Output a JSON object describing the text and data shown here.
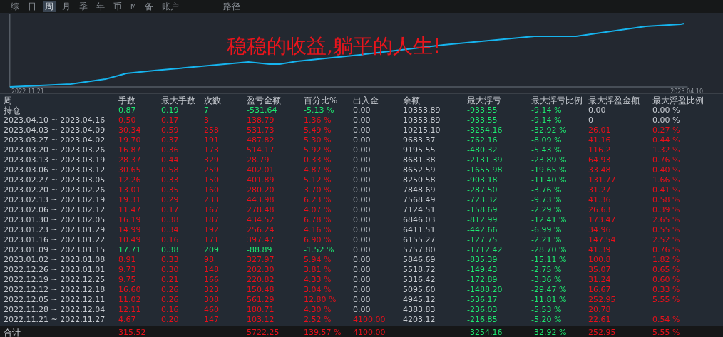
{
  "tabs": [
    {
      "label": "综",
      "selected": false
    },
    {
      "label": "日",
      "selected": false
    },
    {
      "label": "周",
      "selected": true
    },
    {
      "label": "月",
      "selected": false
    },
    {
      "label": "季",
      "selected": false
    },
    {
      "label": "年",
      "selected": false
    },
    {
      "label": "币",
      "selected": false
    },
    {
      "label": "M",
      "selected": false
    },
    {
      "label": "备",
      "selected": false
    },
    {
      "label": "账户",
      "selected": false
    },
    {
      "label": "路径",
      "selected": false
    }
  ],
  "chart": {
    "overlay_text": "稳稳的收益,躺平的人生!",
    "start_label": "2022.11.21",
    "end_label": "2023.04.10"
  },
  "table": {
    "label_column": "周",
    "columns": [
      "手数",
      "最大手数",
      "次数",
      "盈亏金额",
      "百分比%",
      "出入金",
      "余额",
      "最大浮亏",
      "最大浮亏比例",
      "最大浮盈金额",
      "最大浮盈比例"
    ],
    "position": {
      "label": "持仓",
      "cells": [
        {
          "text": "0.87",
          "color": "#1ee870"
        },
        {
          "text": "0.19",
          "color": "#1ee870"
        },
        {
          "text": "7",
          "color": "#1ee870"
        },
        {
          "text": "-531.64",
          "color": "#1ee870"
        },
        {
          "text": "-5.13 %",
          "color": "#1ee870"
        },
        {
          "text": "0.00",
          "color": "#c8ccd2"
        },
        {
          "text": "10353.89",
          "color": "#c8ccd2"
        },
        {
          "text": "-933.55",
          "color": "#1ee870"
        },
        {
          "text": "-9.14 %",
          "color": "#1ee870"
        },
        {
          "text": "0.00",
          "color": "#c8ccd2"
        },
        {
          "text": "0.00 %",
          "color": "#c8ccd2"
        }
      ]
    },
    "rows": [
      {
        "label": "2023.04.10 ~ 2023.04.16",
        "cells": [
          {
            "text": "0.50",
            "color": "#e8101a"
          },
          {
            "text": "0.17",
            "color": "#e8101a"
          },
          {
            "text": "3",
            "color": "#e8101a"
          },
          {
            "text": "138.79",
            "color": "#e8101a"
          },
          {
            "text": "1.36 %",
            "color": "#e8101a"
          },
          {
            "text": "0.00",
            "color": "#c8ccd2"
          },
          {
            "text": "10353.89",
            "color": "#c8ccd2"
          },
          {
            "text": "-933.55",
            "color": "#1ee870"
          },
          {
            "text": "-9.14 %",
            "color": "#1ee870"
          },
          {
            "text": "0",
            "color": "#c8ccd2"
          },
          {
            "text": "0.00 %",
            "color": "#c8ccd2"
          }
        ]
      },
      {
        "label": "2023.04.03 ~ 2023.04.09",
        "cells": [
          {
            "text": "30.34",
            "color": "#e8101a"
          },
          {
            "text": "0.59",
            "color": "#e8101a"
          },
          {
            "text": "258",
            "color": "#e8101a"
          },
          {
            "text": "531.73",
            "color": "#e8101a"
          },
          {
            "text": "5.49 %",
            "color": "#e8101a"
          },
          {
            "text": "0.00",
            "color": "#c8ccd2"
          },
          {
            "text": "10215.10",
            "color": "#c8ccd2"
          },
          {
            "text": "-3254.16",
            "color": "#1ee870"
          },
          {
            "text": "-32.92 %",
            "color": "#1ee870"
          },
          {
            "text": "26.01",
            "color": "#e8101a"
          },
          {
            "text": "0.27 %",
            "color": "#e8101a"
          }
        ]
      },
      {
        "label": "2023.03.27 ~ 2023.04.02",
        "cells": [
          {
            "text": "19.70",
            "color": "#e8101a"
          },
          {
            "text": "0.37",
            "color": "#e8101a"
          },
          {
            "text": "191",
            "color": "#e8101a"
          },
          {
            "text": "487.82",
            "color": "#e8101a"
          },
          {
            "text": "5.30 %",
            "color": "#e8101a"
          },
          {
            "text": "0.00",
            "color": "#c8ccd2"
          },
          {
            "text": "9683.37",
            "color": "#c8ccd2"
          },
          {
            "text": "-762.16",
            "color": "#1ee870"
          },
          {
            "text": "-8.09 %",
            "color": "#1ee870"
          },
          {
            "text": "41.16",
            "color": "#e8101a"
          },
          {
            "text": "0.44 %",
            "color": "#e8101a"
          }
        ]
      },
      {
        "label": "2023.03.20 ~ 2023.03.26",
        "cells": [
          {
            "text": "16.87",
            "color": "#e8101a"
          },
          {
            "text": "0.36",
            "color": "#e8101a"
          },
          {
            "text": "173",
            "color": "#e8101a"
          },
          {
            "text": "514.17",
            "color": "#e8101a"
          },
          {
            "text": "5.92 %",
            "color": "#e8101a"
          },
          {
            "text": "0.00",
            "color": "#c8ccd2"
          },
          {
            "text": "9195.55",
            "color": "#c8ccd2"
          },
          {
            "text": "-480.32",
            "color": "#1ee870"
          },
          {
            "text": "-5.43 %",
            "color": "#1ee870"
          },
          {
            "text": "116.2",
            "color": "#e8101a"
          },
          {
            "text": "1.32 %",
            "color": "#e8101a"
          }
        ]
      },
      {
        "label": "2023.03.13 ~ 2023.03.19",
        "cells": [
          {
            "text": "28.37",
            "color": "#e8101a"
          },
          {
            "text": "0.44",
            "color": "#e8101a"
          },
          {
            "text": "329",
            "color": "#e8101a"
          },
          {
            "text": "28.79",
            "color": "#e8101a"
          },
          {
            "text": "0.33 %",
            "color": "#e8101a"
          },
          {
            "text": "0.00",
            "color": "#c8ccd2"
          },
          {
            "text": "8681.38",
            "color": "#c8ccd2"
          },
          {
            "text": "-2131.39",
            "color": "#1ee870"
          },
          {
            "text": "-23.89 %",
            "color": "#1ee870"
          },
          {
            "text": "64.93",
            "color": "#e8101a"
          },
          {
            "text": "0.76 %",
            "color": "#e8101a"
          }
        ]
      },
      {
        "label": "2023.03.06 ~ 2023.03.12",
        "cells": [
          {
            "text": "30.65",
            "color": "#e8101a"
          },
          {
            "text": "0.58",
            "color": "#e8101a"
          },
          {
            "text": "259",
            "color": "#e8101a"
          },
          {
            "text": "402.01",
            "color": "#e8101a"
          },
          {
            "text": "4.87 %",
            "color": "#e8101a"
          },
          {
            "text": "0.00",
            "color": "#c8ccd2"
          },
          {
            "text": "8652.59",
            "color": "#c8ccd2"
          },
          {
            "text": "-1655.98",
            "color": "#1ee870"
          },
          {
            "text": "-19.65 %",
            "color": "#1ee870"
          },
          {
            "text": "33.48",
            "color": "#e8101a"
          },
          {
            "text": "0.40 %",
            "color": "#e8101a"
          }
        ]
      },
      {
        "label": "2023.02.27 ~ 2023.03.05",
        "cells": [
          {
            "text": "12.26",
            "color": "#e8101a"
          },
          {
            "text": "0.33",
            "color": "#e8101a"
          },
          {
            "text": "150",
            "color": "#e8101a"
          },
          {
            "text": "401.89",
            "color": "#e8101a"
          },
          {
            "text": "5.12 %",
            "color": "#e8101a"
          },
          {
            "text": "0.00",
            "color": "#c8ccd2"
          },
          {
            "text": "8250.58",
            "color": "#c8ccd2"
          },
          {
            "text": "-903.18",
            "color": "#1ee870"
          },
          {
            "text": "-11.40 %",
            "color": "#1ee870"
          },
          {
            "text": "131.77",
            "color": "#e8101a"
          },
          {
            "text": "1.66 %",
            "color": "#e8101a"
          }
        ]
      },
      {
        "label": "2023.02.20 ~ 2023.02.26",
        "cells": [
          {
            "text": "13.01",
            "color": "#e8101a"
          },
          {
            "text": "0.35",
            "color": "#e8101a"
          },
          {
            "text": "160",
            "color": "#e8101a"
          },
          {
            "text": "280.20",
            "color": "#e8101a"
          },
          {
            "text": "3.70 %",
            "color": "#e8101a"
          },
          {
            "text": "0.00",
            "color": "#c8ccd2"
          },
          {
            "text": "7848.69",
            "color": "#c8ccd2"
          },
          {
            "text": "-287.50",
            "color": "#1ee870"
          },
          {
            "text": "-3.76 %",
            "color": "#1ee870"
          },
          {
            "text": "31.27",
            "color": "#e8101a"
          },
          {
            "text": "0.41 %",
            "color": "#e8101a"
          }
        ]
      },
      {
        "label": "2023.02.13 ~ 2023.02.19",
        "cells": [
          {
            "text": "19.31",
            "color": "#e8101a"
          },
          {
            "text": "0.29",
            "color": "#e8101a"
          },
          {
            "text": "233",
            "color": "#e8101a"
          },
          {
            "text": "443.98",
            "color": "#e8101a"
          },
          {
            "text": "6.23 %",
            "color": "#e8101a"
          },
          {
            "text": "0.00",
            "color": "#c8ccd2"
          },
          {
            "text": "7568.49",
            "color": "#c8ccd2"
          },
          {
            "text": "-723.32",
            "color": "#1ee870"
          },
          {
            "text": "-9.73 %",
            "color": "#1ee870"
          },
          {
            "text": "41.36",
            "color": "#e8101a"
          },
          {
            "text": "0.58 %",
            "color": "#e8101a"
          }
        ]
      },
      {
        "label": "2023.02.06 ~ 2023.02.12",
        "cells": [
          {
            "text": "11.47",
            "color": "#e8101a"
          },
          {
            "text": "0.17",
            "color": "#e8101a"
          },
          {
            "text": "167",
            "color": "#e8101a"
          },
          {
            "text": "278.48",
            "color": "#e8101a"
          },
          {
            "text": "4.07 %",
            "color": "#e8101a"
          },
          {
            "text": "0.00",
            "color": "#c8ccd2"
          },
          {
            "text": "7124.51",
            "color": "#c8ccd2"
          },
          {
            "text": "-158.69",
            "color": "#1ee870"
          },
          {
            "text": "-2.29 %",
            "color": "#1ee870"
          },
          {
            "text": "26.63",
            "color": "#e8101a"
          },
          {
            "text": "0.39 %",
            "color": "#e8101a"
          }
        ]
      },
      {
        "label": "2023.01.30 ~ 2023.02.05",
        "cells": [
          {
            "text": "16.19",
            "color": "#e8101a"
          },
          {
            "text": "0.38",
            "color": "#e8101a"
          },
          {
            "text": "187",
            "color": "#e8101a"
          },
          {
            "text": "434.52",
            "color": "#e8101a"
          },
          {
            "text": "6.78 %",
            "color": "#e8101a"
          },
          {
            "text": "0.00",
            "color": "#c8ccd2"
          },
          {
            "text": "6846.03",
            "color": "#c8ccd2"
          },
          {
            "text": "-812.99",
            "color": "#1ee870"
          },
          {
            "text": "-12.41 %",
            "color": "#1ee870"
          },
          {
            "text": "173.47",
            "color": "#e8101a"
          },
          {
            "text": "2.65 %",
            "color": "#e8101a"
          }
        ]
      },
      {
        "label": "2023.01.23 ~ 2023.01.29",
        "cells": [
          {
            "text": "14.99",
            "color": "#e8101a"
          },
          {
            "text": "0.34",
            "color": "#e8101a"
          },
          {
            "text": "192",
            "color": "#e8101a"
          },
          {
            "text": "256.24",
            "color": "#e8101a"
          },
          {
            "text": "4.16 %",
            "color": "#e8101a"
          },
          {
            "text": "0.00",
            "color": "#c8ccd2"
          },
          {
            "text": "6411.51",
            "color": "#c8ccd2"
          },
          {
            "text": "-442.66",
            "color": "#1ee870"
          },
          {
            "text": "-6.99 %",
            "color": "#1ee870"
          },
          {
            "text": "34.96",
            "color": "#e8101a"
          },
          {
            "text": "0.55 %",
            "color": "#e8101a"
          }
        ]
      },
      {
        "label": "2023.01.16 ~ 2023.01.22",
        "cells": [
          {
            "text": "10.49",
            "color": "#e8101a"
          },
          {
            "text": "0.16",
            "color": "#e8101a"
          },
          {
            "text": "171",
            "color": "#e8101a"
          },
          {
            "text": "397.47",
            "color": "#e8101a"
          },
          {
            "text": "6.90 %",
            "color": "#e8101a"
          },
          {
            "text": "0.00",
            "color": "#c8ccd2"
          },
          {
            "text": "6155.27",
            "color": "#c8ccd2"
          },
          {
            "text": "-127.75",
            "color": "#1ee870"
          },
          {
            "text": "-2.21 %",
            "color": "#1ee870"
          },
          {
            "text": "147.54",
            "color": "#e8101a"
          },
          {
            "text": "2.52 %",
            "color": "#e8101a"
          }
        ]
      },
      {
        "label": "2023.01.09 ~ 2023.01.15",
        "cells": [
          {
            "text": "17.71",
            "color": "#1ee870"
          },
          {
            "text": "0.38",
            "color": "#1ee870"
          },
          {
            "text": "209",
            "color": "#1ee870"
          },
          {
            "text": "-88.89",
            "color": "#1ee870"
          },
          {
            "text": "-1.52 %",
            "color": "#1ee870"
          },
          {
            "text": "0.00",
            "color": "#c8ccd2"
          },
          {
            "text": "5757.80",
            "color": "#c8ccd2"
          },
          {
            "text": "-1712.42",
            "color": "#1ee870"
          },
          {
            "text": "-28.70 %",
            "color": "#1ee870"
          },
          {
            "text": "41.39",
            "color": "#e8101a"
          },
          {
            "text": "0.76 %",
            "color": "#e8101a"
          }
        ]
      },
      {
        "label": "2023.01.02 ~ 2023.01.08",
        "cells": [
          {
            "text": "8.91",
            "color": "#e8101a"
          },
          {
            "text": "0.33",
            "color": "#e8101a"
          },
          {
            "text": "98",
            "color": "#e8101a"
          },
          {
            "text": "327.97",
            "color": "#e8101a"
          },
          {
            "text": "5.94 %",
            "color": "#e8101a"
          },
          {
            "text": "0.00",
            "color": "#c8ccd2"
          },
          {
            "text": "5846.69",
            "color": "#c8ccd2"
          },
          {
            "text": "-835.39",
            "color": "#1ee870"
          },
          {
            "text": "-15.11 %",
            "color": "#1ee870"
          },
          {
            "text": "100.8",
            "color": "#e8101a"
          },
          {
            "text": "1.82 %",
            "color": "#e8101a"
          }
        ]
      },
      {
        "label": "2022.12.26 ~ 2023.01.01",
        "cells": [
          {
            "text": "9.73",
            "color": "#e8101a"
          },
          {
            "text": "0.30",
            "color": "#e8101a"
          },
          {
            "text": "148",
            "color": "#e8101a"
          },
          {
            "text": "202.30",
            "color": "#e8101a"
          },
          {
            "text": "3.81 %",
            "color": "#e8101a"
          },
          {
            "text": "0.00",
            "color": "#c8ccd2"
          },
          {
            "text": "5518.72",
            "color": "#c8ccd2"
          },
          {
            "text": "-149.43",
            "color": "#1ee870"
          },
          {
            "text": "-2.75 %",
            "color": "#1ee870"
          },
          {
            "text": "35.07",
            "color": "#e8101a"
          },
          {
            "text": "0.65 %",
            "color": "#e8101a"
          }
        ]
      },
      {
        "label": "2022.12.19 ~ 2022.12.25",
        "cells": [
          {
            "text": "9.75",
            "color": "#e8101a"
          },
          {
            "text": "0.21",
            "color": "#e8101a"
          },
          {
            "text": "166",
            "color": "#e8101a"
          },
          {
            "text": "220.82",
            "color": "#e8101a"
          },
          {
            "text": "4.33 %",
            "color": "#e8101a"
          },
          {
            "text": "0.00",
            "color": "#c8ccd2"
          },
          {
            "text": "5316.42",
            "color": "#c8ccd2"
          },
          {
            "text": "-172.89",
            "color": "#1ee870"
          },
          {
            "text": "-3.36 %",
            "color": "#1ee870"
          },
          {
            "text": "31.24",
            "color": "#e8101a"
          },
          {
            "text": "0.60 %",
            "color": "#e8101a"
          }
        ]
      },
      {
        "label": "2022.12.12 ~ 2022.12.18",
        "cells": [
          {
            "text": "16.60",
            "color": "#e8101a"
          },
          {
            "text": "0.26",
            "color": "#e8101a"
          },
          {
            "text": "323",
            "color": "#e8101a"
          },
          {
            "text": "150.48",
            "color": "#e8101a"
          },
          {
            "text": "3.04 %",
            "color": "#e8101a"
          },
          {
            "text": "0.00",
            "color": "#c8ccd2"
          },
          {
            "text": "5095.60",
            "color": "#c8ccd2"
          },
          {
            "text": "-1488.20",
            "color": "#1ee870"
          },
          {
            "text": "-29.47 %",
            "color": "#1ee870"
          },
          {
            "text": "16.67",
            "color": "#e8101a"
          },
          {
            "text": "0.33 %",
            "color": "#e8101a"
          }
        ]
      },
      {
        "label": "2022.12.05 ~ 2022.12.11",
        "cells": [
          {
            "text": "11.02",
            "color": "#e8101a"
          },
          {
            "text": "0.26",
            "color": "#e8101a"
          },
          {
            "text": "308",
            "color": "#e8101a"
          },
          {
            "text": "561.29",
            "color": "#e8101a"
          },
          {
            "text": "12.80 %",
            "color": "#e8101a"
          },
          {
            "text": "0.00",
            "color": "#c8ccd2"
          },
          {
            "text": "4945.12",
            "color": "#c8ccd2"
          },
          {
            "text": "-536.17",
            "color": "#1ee870"
          },
          {
            "text": "-11.81 %",
            "color": "#1ee870"
          },
          {
            "text": "252.95",
            "color": "#e8101a"
          },
          {
            "text": "5.55 %",
            "color": "#e8101a"
          }
        ]
      },
      {
        "label": "2022.11.28 ~ 2022.12.04",
        "cells": [
          {
            "text": "12.11",
            "color": "#e8101a"
          },
          {
            "text": "0.16",
            "color": "#e8101a"
          },
          {
            "text": "460",
            "color": "#e8101a"
          },
          {
            "text": "180.71",
            "color": "#e8101a"
          },
          {
            "text": "4.30 %",
            "color": "#e8101a"
          },
          {
            "text": "0.00",
            "color": "#c8ccd2"
          },
          {
            "text": "4383.83",
            "color": "#c8ccd2"
          },
          {
            "text": "-236.03",
            "color": "#1ee870"
          },
          {
            "text": "-5.53 %",
            "color": "#1ee870"
          },
          {
            "text": "20.78",
            "color": "#e8101a"
          },
          null
        ]
      },
      {
        "label": "2022.11.21 ~ 2022.11.27",
        "cells": [
          {
            "text": "4.67",
            "color": "#e8101a"
          },
          {
            "text": "0.20",
            "color": "#e8101a"
          },
          {
            "text": "147",
            "color": "#e8101a"
          },
          {
            "text": "103.12",
            "color": "#e8101a"
          },
          {
            "text": "2.52 %",
            "color": "#e8101a"
          },
          {
            "text": "4100.00",
            "color": "#e8101a"
          },
          {
            "text": "4203.12",
            "color": "#c8ccd2"
          },
          {
            "text": "-216.85",
            "color": "#1ee870"
          },
          {
            "text": "-5.20 %",
            "color": "#1ee870"
          },
          {
            "text": "22.61",
            "color": "#e8101a"
          },
          {
            "text": "0.54 %",
            "color": "#e8101a"
          }
        ]
      }
    ],
    "total": {
      "label": "合计",
      "cells": [
        {
          "text": "315.52",
          "color": "#e8101a"
        },
        null,
        null,
        {
          "text": "5722.25",
          "color": "#e8101a"
        },
        {
          "text": "139.57 %",
          "color": "#e8101a"
        },
        {
          "text": "4100.00",
          "color": "#e8101a"
        },
        null,
        {
          "text": "-3254.16",
          "color": "#1ee870"
        },
        {
          "text": "-32.92 %",
          "color": "#1ee870"
        },
        {
          "text": "252.95",
          "color": "#e8101a"
        },
        {
          "text": "5.55 %",
          "color": "#e8101a"
        }
      ]
    }
  }
}
